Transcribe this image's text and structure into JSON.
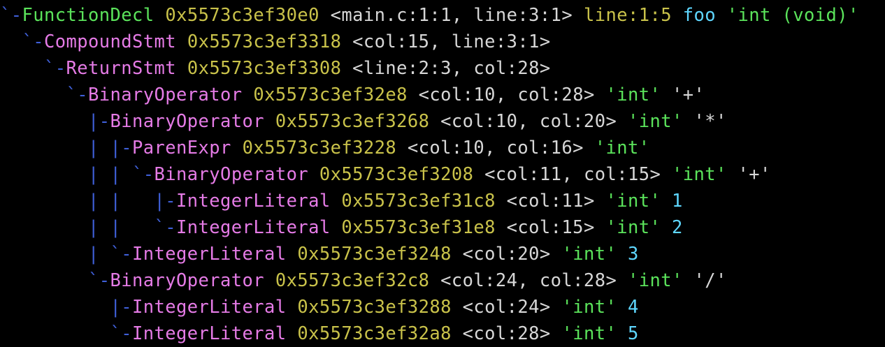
{
  "colors": {
    "background": "#000000",
    "tree_prefix": "#3f5fd8",
    "decl_node": "#5be35b",
    "stmt_expr_node": "#e57be6",
    "address": "#c9c24a",
    "source_range": "#d7d7d7",
    "decl_name": "#5fd7ff",
    "type": "#5be35b",
    "operator": "#d7d7d7",
    "literal_value": "#5fd7ff"
  },
  "ast_lines": [
    {
      "prefix": "`-",
      "node": "FunctionDecl",
      "addr": "0x5573c3ef30e0",
      "range": "<main.c:1:1, line:3:1>",
      "loc": "line:1:5",
      "name": "foo",
      "type": "'int (void)'",
      "op": "",
      "value": ""
    },
    {
      "prefix": "  `-",
      "node": "CompoundStmt",
      "addr": "0x5573c3ef3318",
      "range": "<col:15, line:3:1>",
      "loc": "",
      "name": "",
      "type": "",
      "op": "",
      "value": ""
    },
    {
      "prefix": "    `-",
      "node": "ReturnStmt",
      "addr": "0x5573c3ef3308",
      "range": "<line:2:3, col:28>",
      "loc": "",
      "name": "",
      "type": "",
      "op": "",
      "value": ""
    },
    {
      "prefix": "      `-",
      "node": "BinaryOperator",
      "addr": "0x5573c3ef32e8",
      "range": "<col:10, col:28>",
      "loc": "",
      "name": "",
      "type": "'int'",
      "op": "'+'",
      "value": ""
    },
    {
      "prefix": "        |-",
      "node": "BinaryOperator",
      "addr": "0x5573c3ef3268",
      "range": "<col:10, col:20>",
      "loc": "",
      "name": "",
      "type": "'int'",
      "op": "'*'",
      "value": ""
    },
    {
      "prefix": "        | |-",
      "node": "ParenExpr",
      "addr": "0x5573c3ef3228",
      "range": "<col:10, col:16>",
      "loc": "",
      "name": "",
      "type": "'int'",
      "op": "",
      "value": ""
    },
    {
      "prefix": "        | | `-",
      "node": "BinaryOperator",
      "addr": "0x5573c3ef3208",
      "range": "<col:11, col:15>",
      "loc": "",
      "name": "",
      "type": "'int'",
      "op": "'+'",
      "value": ""
    },
    {
      "prefix": "        | |   |-",
      "node": "IntegerLiteral",
      "addr": "0x5573c3ef31c8",
      "range": "<col:11>",
      "loc": "",
      "name": "",
      "type": "'int'",
      "op": "",
      "value": "1"
    },
    {
      "prefix": "        | |   `-",
      "node": "IntegerLiteral",
      "addr": "0x5573c3ef31e8",
      "range": "<col:15>",
      "loc": "",
      "name": "",
      "type": "'int'",
      "op": "",
      "value": "2"
    },
    {
      "prefix": "        | `-",
      "node": "IntegerLiteral",
      "addr": "0x5573c3ef3248",
      "range": "<col:20>",
      "loc": "",
      "name": "",
      "type": "'int'",
      "op": "",
      "value": "3"
    },
    {
      "prefix": "        `-",
      "node": "BinaryOperator",
      "addr": "0x5573c3ef32c8",
      "range": "<col:24, col:28>",
      "loc": "",
      "name": "",
      "type": "'int'",
      "op": "'/'",
      "value": ""
    },
    {
      "prefix": "          |-",
      "node": "IntegerLiteral",
      "addr": "0x5573c3ef3288",
      "range": "<col:24>",
      "loc": "",
      "name": "",
      "type": "'int'",
      "op": "",
      "value": "4"
    },
    {
      "prefix": "          `-",
      "node": "IntegerLiteral",
      "addr": "0x5573c3ef32a8",
      "range": "<col:28>",
      "loc": "",
      "name": "",
      "type": "'int'",
      "op": "",
      "value": "5"
    }
  ]
}
